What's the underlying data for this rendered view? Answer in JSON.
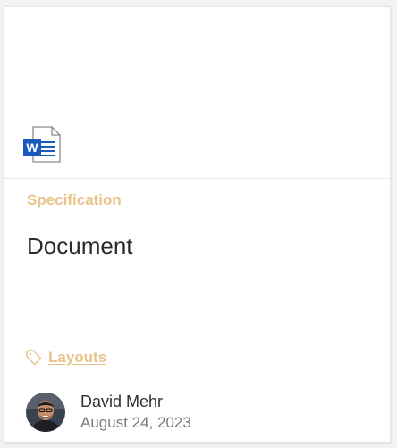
{
  "card": {
    "file_type_icon": "word-document-icon",
    "category": "Specification",
    "title": "Document",
    "tag": {
      "icon": "tag-icon",
      "label": "Layouts"
    },
    "author": {
      "name": "David Mehr",
      "date": "August 24, 2023"
    }
  },
  "colors": {
    "link_accent": "#e7c48a",
    "word_blue": "#185abd"
  }
}
